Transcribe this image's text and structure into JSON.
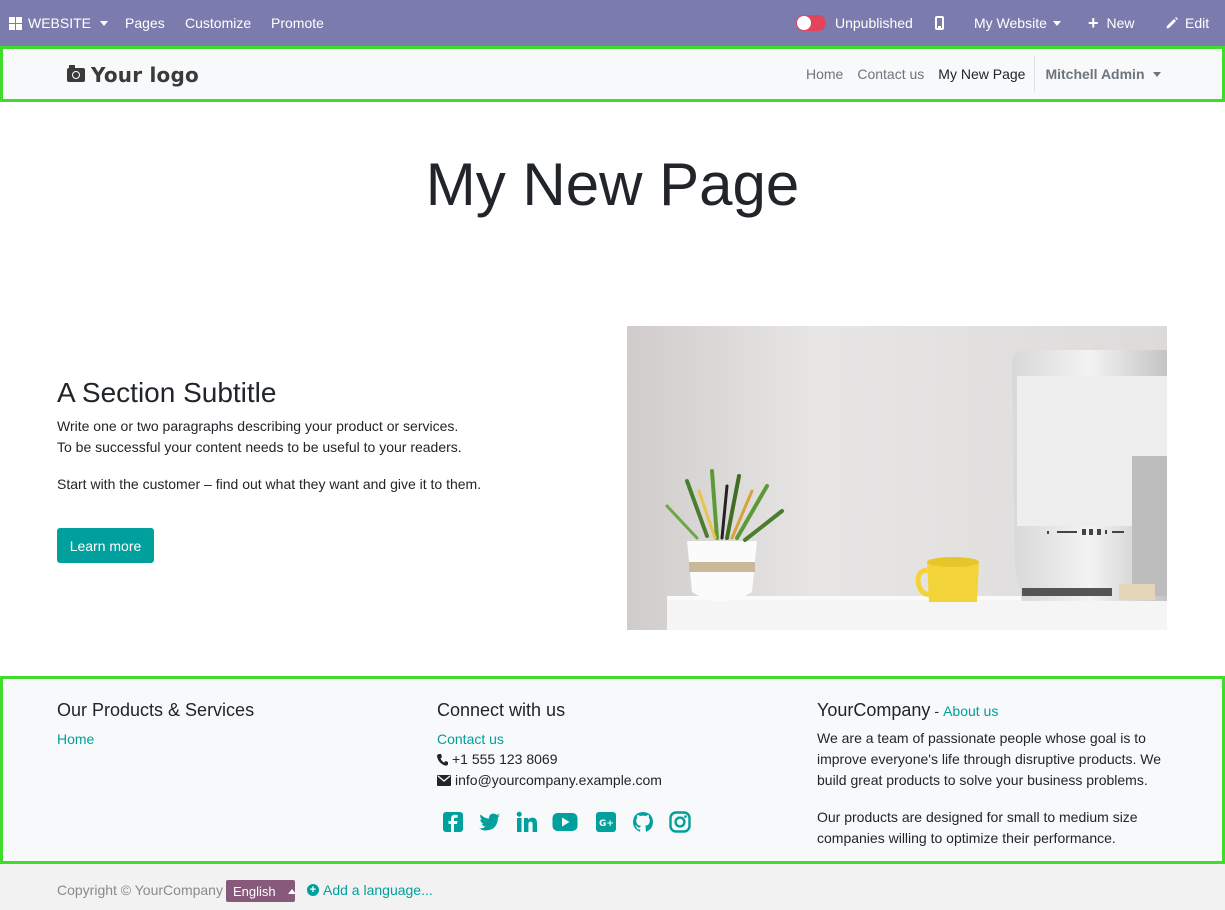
{
  "adminbar": {
    "app_label": "WEBSITE",
    "pages": "Pages",
    "customize": "Customize",
    "promote": "Promote",
    "publish_status": "Unpublished",
    "website_label": "My Website",
    "new_label": "New",
    "edit_label": "Edit",
    "bg_color": "#7c7bad",
    "toggle_color": "#e2445c"
  },
  "header": {
    "logo_text": "Your logo",
    "nav": [
      "Home",
      "Contact us",
      "My New Page"
    ],
    "active_nav": "My New Page",
    "user": "Mitchell Admin"
  },
  "main": {
    "page_title": "My New Page",
    "section_subtitle": "A Section Subtitle",
    "para1_line1": "Write one or two paragraphs describing your product or services.",
    "para1_line2": "To be successful your content needs to be useful to your readers.",
    "para2": "Start with the customer – find out what they want and give it to them.",
    "button_label": "Learn more",
    "accent_color": "#00a09d"
  },
  "footer": {
    "col1_title": "Our Products & Services",
    "col1_link": "Home",
    "col2_title": "Connect with us",
    "col2_link": "Contact us",
    "phone": "+1 555 123 8069",
    "email": "info@yourcompany.example.com",
    "social_icons": [
      "facebook-icon",
      "twitter-icon",
      "linkedin-icon",
      "youtube-icon",
      "google-plus-icon",
      "github-icon",
      "instagram-icon"
    ],
    "col3_title": "YourCompany",
    "col3_dash": "-",
    "col3_link": "About us",
    "col3_para1": "We are a team of passionate people whose goal is to improve everyone's life through disruptive products. We build great products to solve your business problems.",
    "col3_para2": "Our products are designed for small to medium size companies willing to optimize their performance."
  },
  "copyright": {
    "text": "Copyright © YourCompany",
    "language": "English",
    "add_language": "Add a language..."
  }
}
